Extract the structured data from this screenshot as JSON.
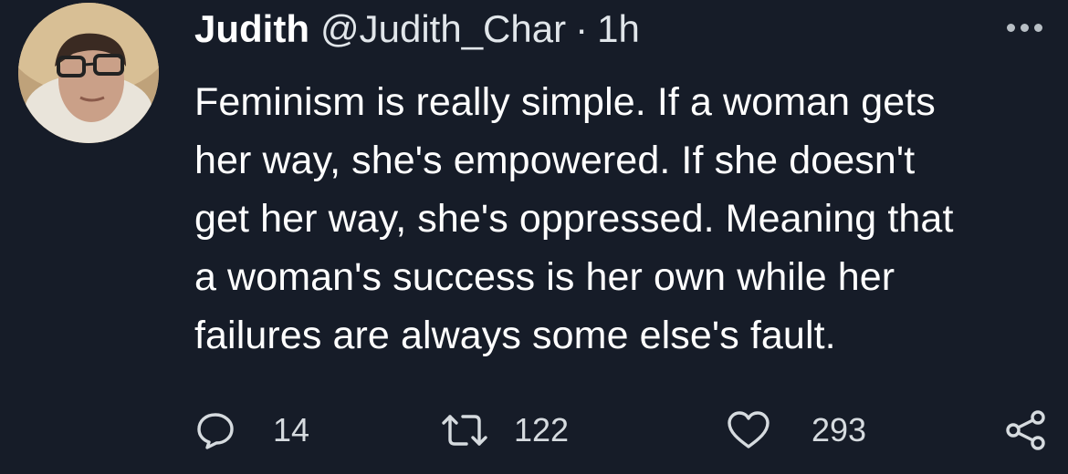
{
  "tweet": {
    "display_name": "Judith",
    "handle": "@Judith_Char",
    "separator": "·",
    "timestamp": "1h",
    "text": "Feminism is really simple. If a woman gets her way, she's empowered. If she doesn't get her way, she's oppressed. Meaning that a woman's success is her own while her failures are always some else's fault.",
    "text_lines": [
      "Feminism is really simple. If a woman gets",
      "her way, she's empowered. If she doesn't",
      "get her way, she's oppressed. Meaning that",
      "a woman's success is her own while her",
      "failures are always some else's fault."
    ]
  },
  "actions": {
    "reply_count": "14",
    "retweet_count": "122",
    "like_count": "293"
  },
  "icons": {
    "more": "more-horizontal-icon",
    "reply": "reply-icon",
    "retweet": "retweet-icon",
    "like": "heart-icon",
    "share": "share-icon"
  },
  "colors": {
    "background": "#161c28",
    "text": "#ffffff",
    "secondary": "#d6dbdf"
  }
}
